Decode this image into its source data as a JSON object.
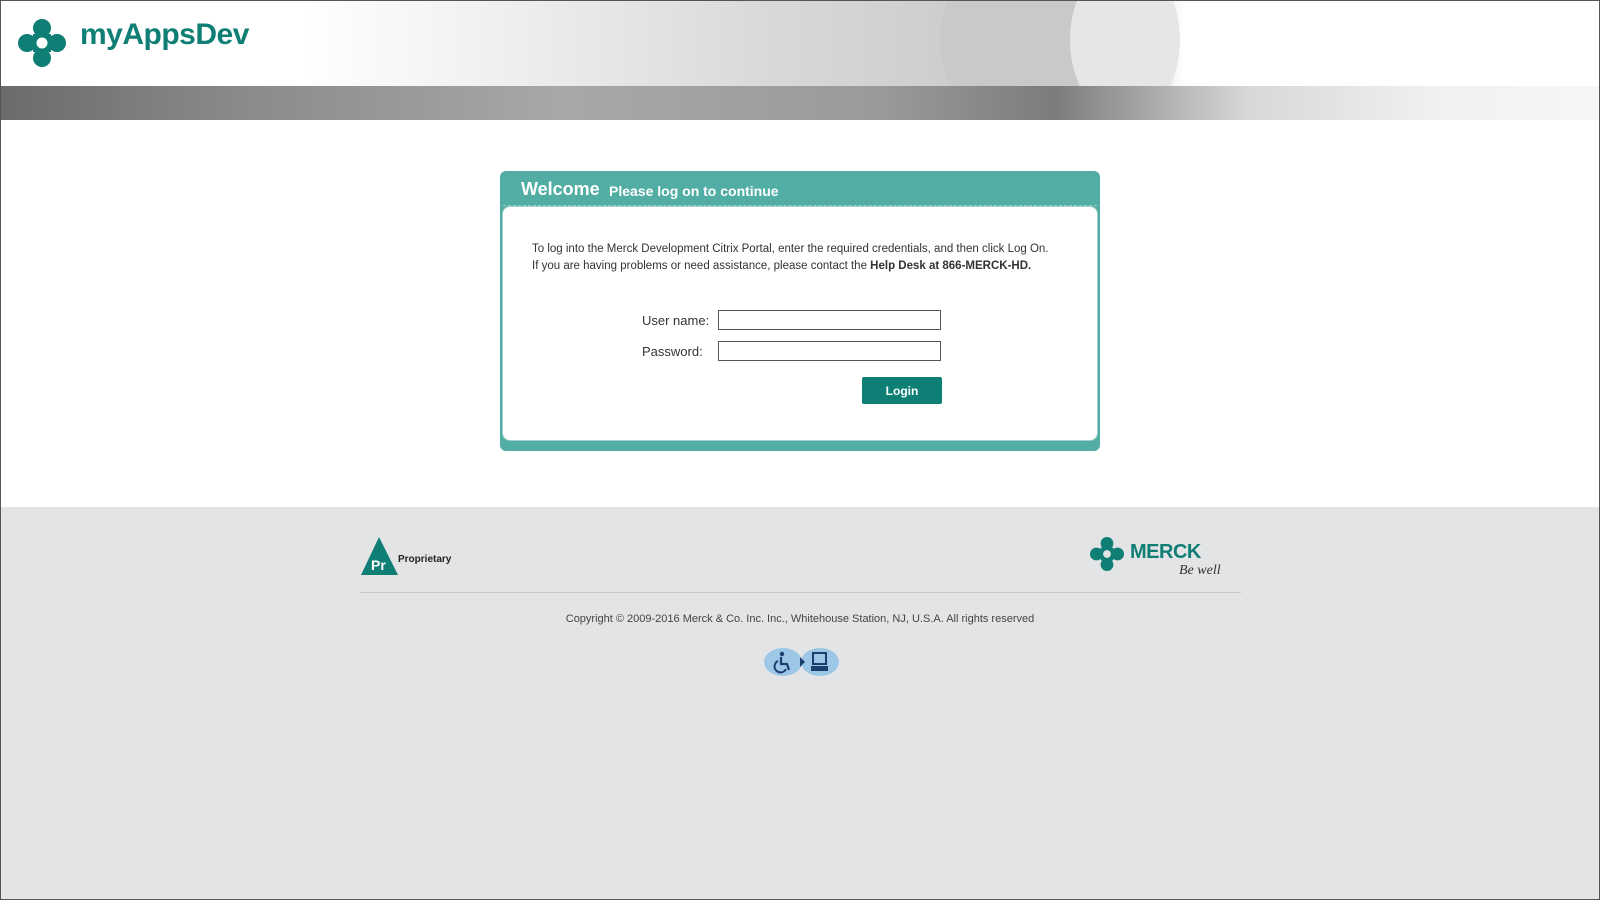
{
  "header": {
    "brand": "myAppsDev"
  },
  "login_panel": {
    "welcome": "Welcome",
    "subtitle": "Please log on to continue",
    "intro_line1": "To log into the Merck Development Citrix Portal, enter the required credentials, and then click Log On.",
    "intro_line2_prefix": "If you are having problems or need assistance, please contact the ",
    "intro_line2_bold": "Help Desk at 866-MERCK-HD.",
    "username_label": "User name:",
    "username_value": "",
    "password_label": "Password:",
    "password_value": "",
    "login_button": "Login"
  },
  "footer": {
    "proprietary_mark": "Pr",
    "proprietary_text": "Proprietary",
    "merck_word": "MERCK",
    "merck_tagline": "Be well",
    "copyright": "Copyright © 2009-2016 Merck & Co. Inc. Inc., Whitehouse Station, NJ, U.S.A. All rights reserved"
  },
  "colors": {
    "brand_teal": "#0f7e74",
    "panel_teal": "#52aea4",
    "button_teal": "#0d7f75"
  },
  "icons": {
    "header_logo": "merck-logo-icon",
    "accessibility": "accessibility-icon"
  }
}
